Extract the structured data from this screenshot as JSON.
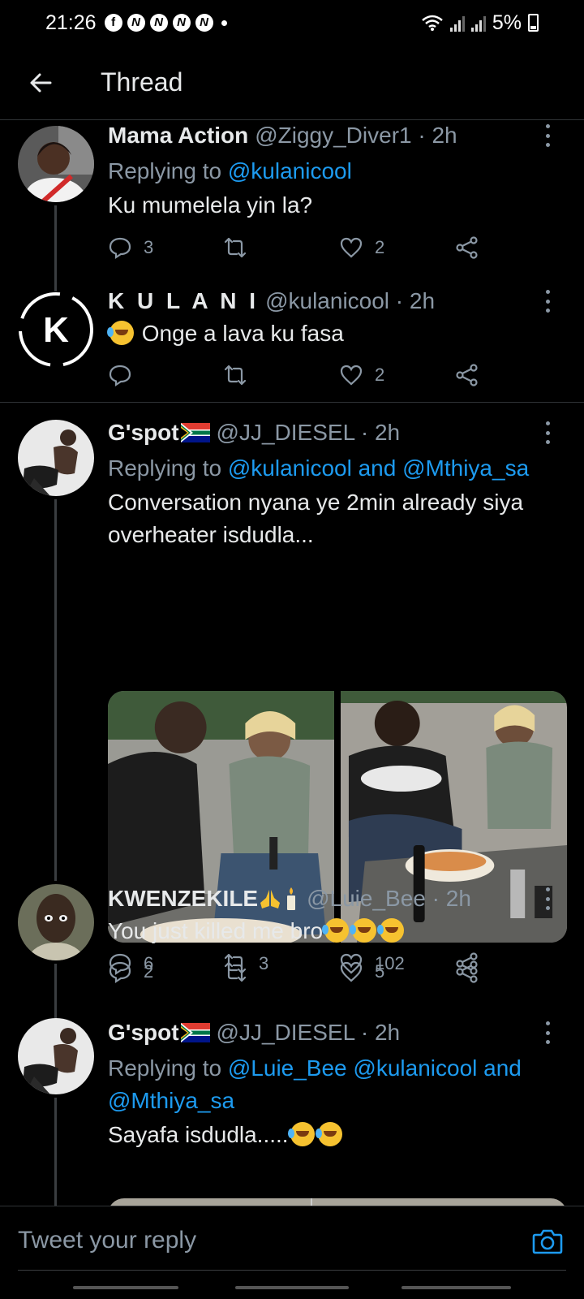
{
  "status_bar": {
    "time": "21:26",
    "battery": "5%",
    "notification_icons": [
      "N",
      "N",
      "N",
      "N"
    ]
  },
  "header": {
    "title": "Thread"
  },
  "tweets": [
    {
      "name": "Mama Action",
      "handle": "@Ziggy_Diver1 · 2h",
      "replying_label": "Replying to ",
      "mentions": "@kulanicool",
      "text": "Ku mumelela yin la?",
      "replies": "3",
      "retweets": "",
      "likes": "2"
    },
    {
      "name": "K U L A N I",
      "handle": "@kulanicool · 2h",
      "text": "Onge a lava ku fasa",
      "replies": "",
      "retweets": "",
      "likes": "2",
      "avatar_letter": "K"
    },
    {
      "name": "G'spot",
      "handle": "@JJ_DIESEL · 2h",
      "replying_label": "Replying to ",
      "mentions": "@kulanicool and @Mthiya_sa",
      "text": "Conversation nyana ye 2min already siya overheater  isdudla...",
      "replies": "6",
      "retweets": "3",
      "likes": "102"
    },
    {
      "name": "KWENZEKILE",
      "handle": "@Luie_Bee · 2h",
      "text": "You just killed me bro",
      "replies": "2",
      "retweets": "",
      "likes": "5"
    },
    {
      "name": "G'spot",
      "handle": "@JJ_DIESEL · 2h",
      "replying_label": "Replying to ",
      "mentions": "@Luie_Bee @kulanicool and @Mthiya_sa",
      "text": "Sayafa isdudla.....",
      "replies": "",
      "retweets": "",
      "likes": ""
    }
  ],
  "compose": {
    "placeholder": "Tweet your reply"
  },
  "colors": {
    "background": "#000000",
    "accent": "#1d9bf0",
    "secondary_text": "#8b98a5",
    "divider": "#2f3336"
  }
}
